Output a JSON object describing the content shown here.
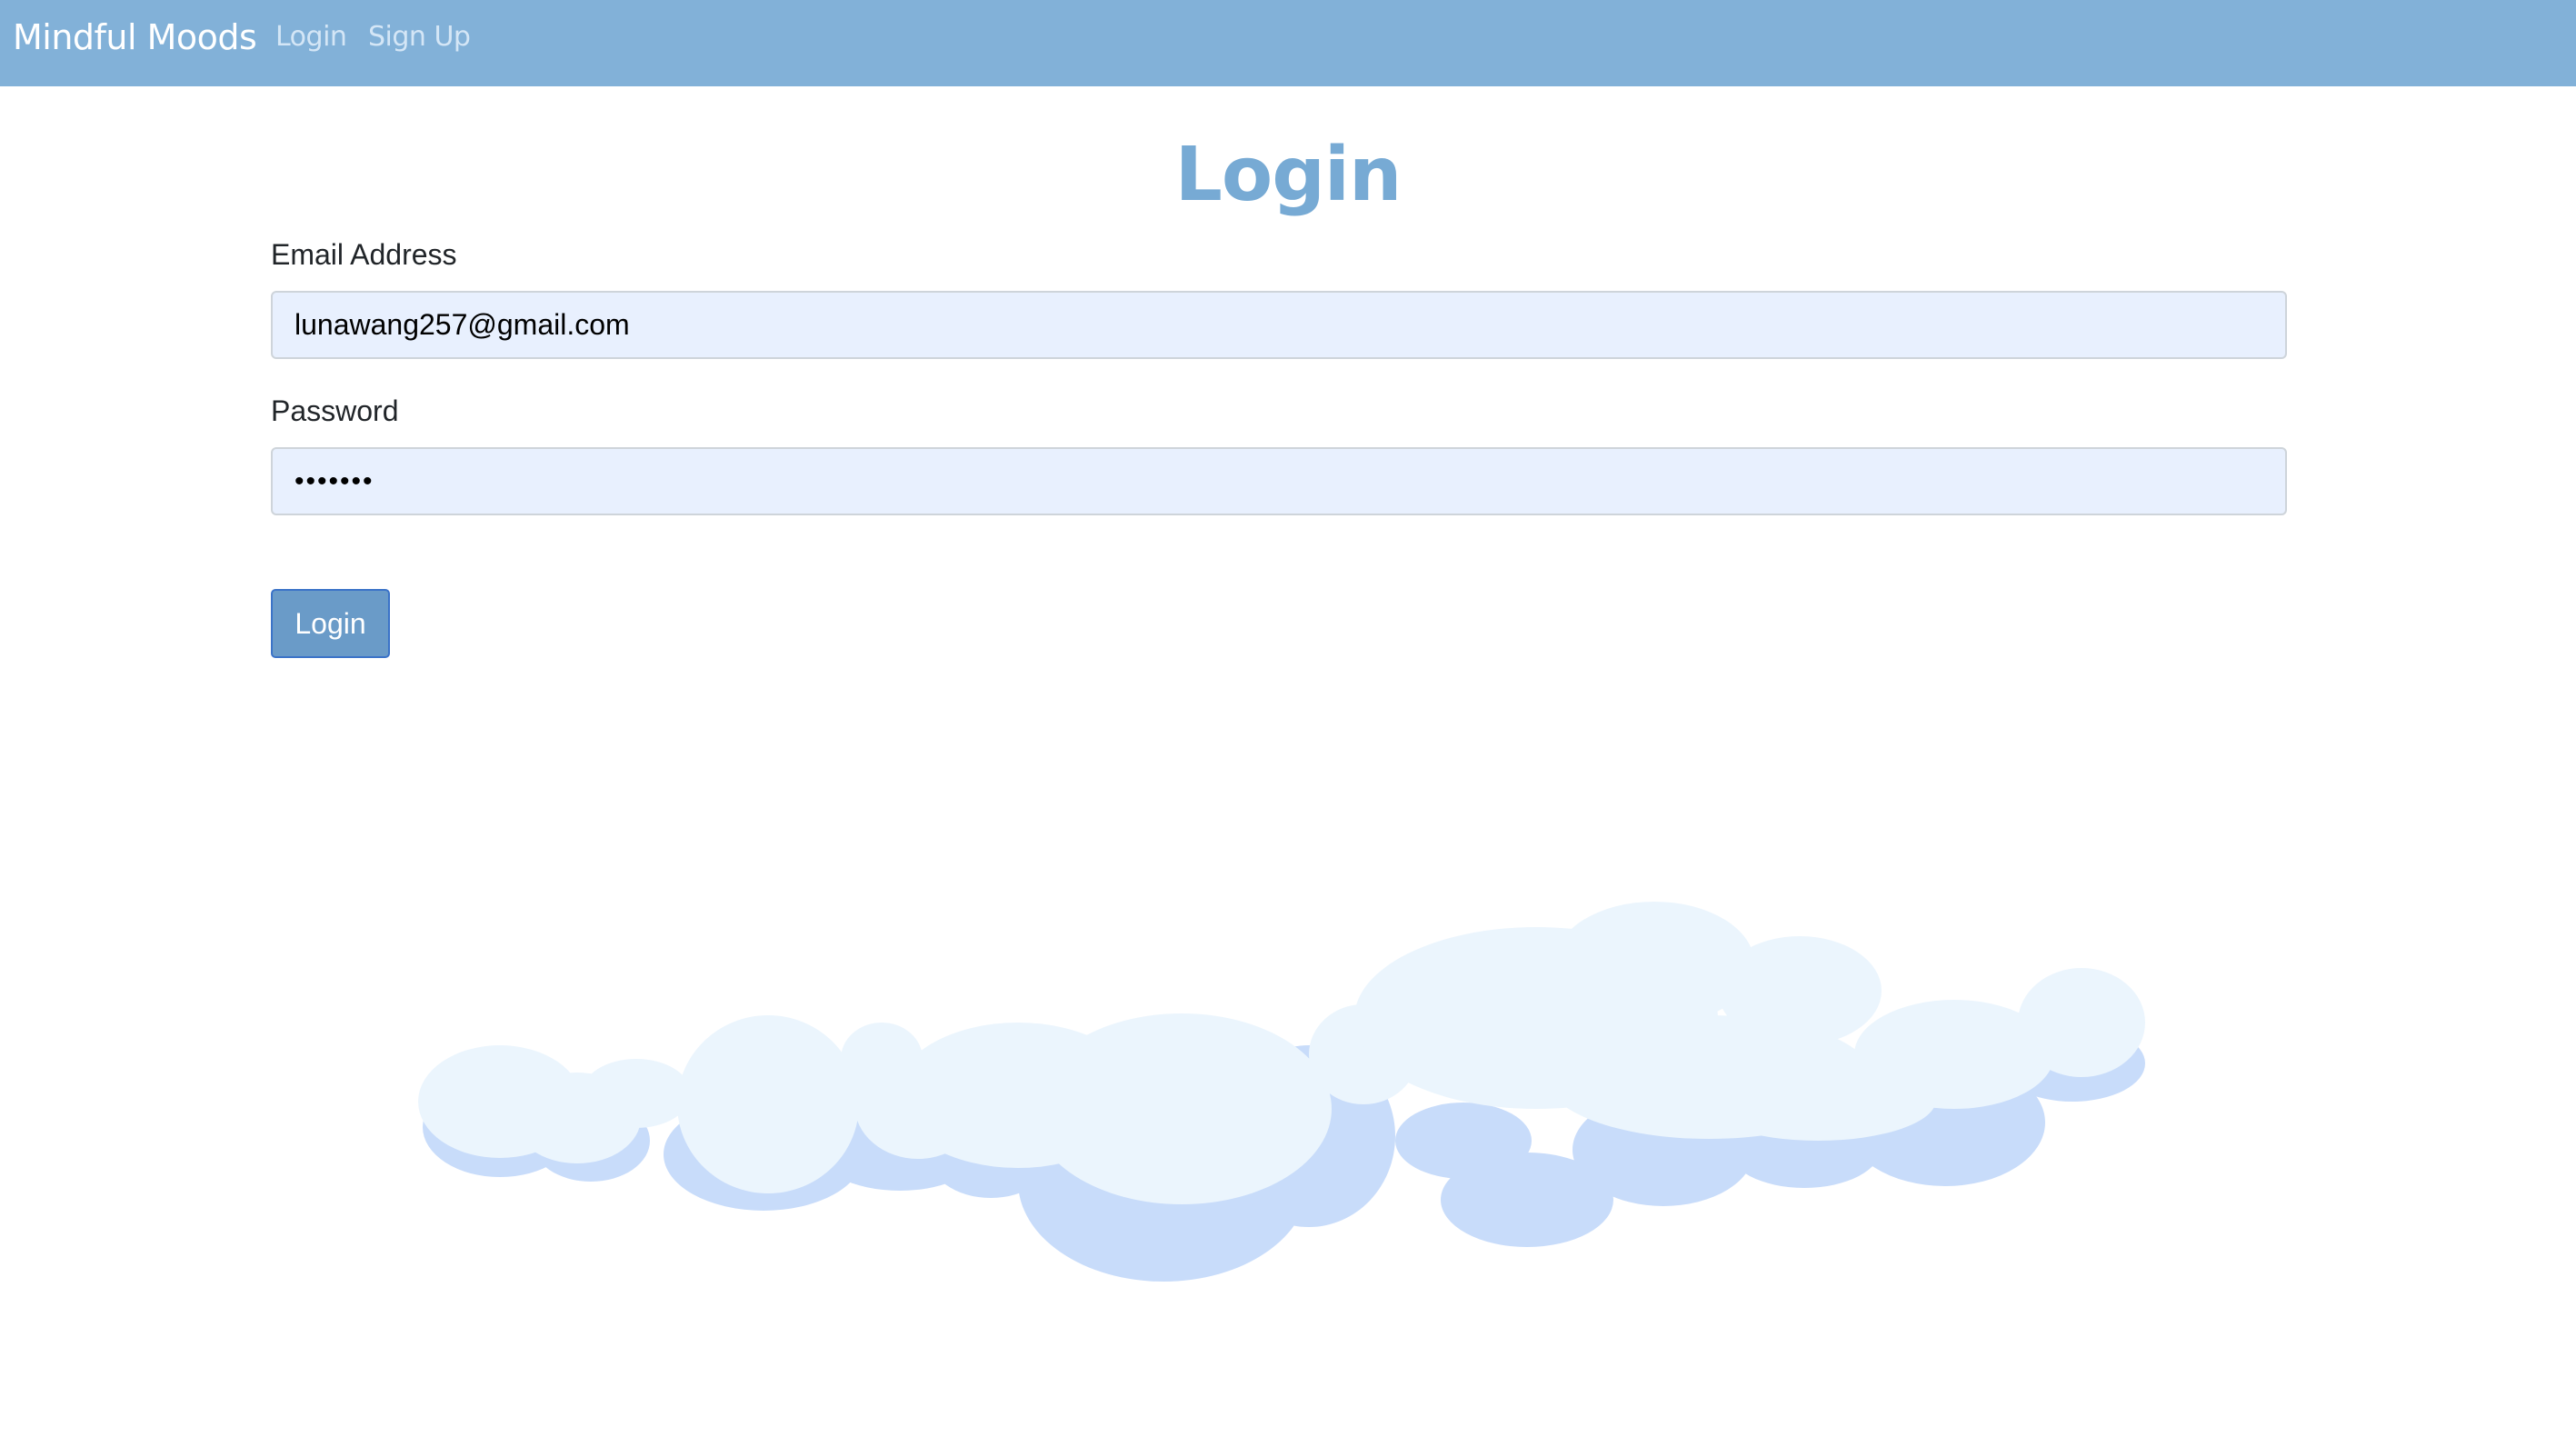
{
  "navbar": {
    "brand": "Mindful Moods",
    "links": [
      {
        "label": "Login"
      },
      {
        "label": "Sign Up"
      }
    ],
    "color": "#82b1d8"
  },
  "main": {
    "title": "Login",
    "title_color": "#77aad4",
    "email": {
      "label": "Email Address",
      "value": "lunawang257@gmail.com"
    },
    "password": {
      "label": "Password",
      "value": "1234567"
    },
    "submit_label": "Login",
    "button_color": "#6a9bc8"
  },
  "decoration": {
    "icon": "cloud-illustration",
    "cloud_light": "#ebf5fd",
    "cloud_shadow": "#c8dcfa"
  }
}
